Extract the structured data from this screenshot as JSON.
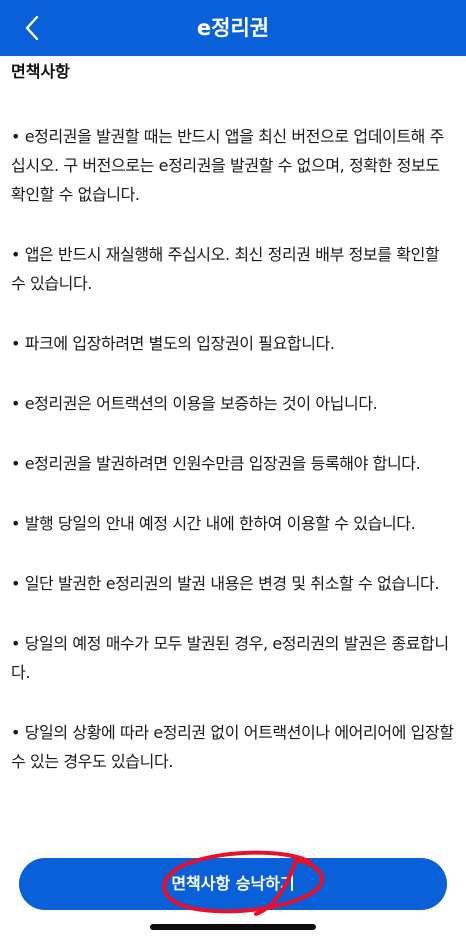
{
  "header": {
    "title": "e정리권",
    "back_icon": "chevron-left-icon"
  },
  "content": {
    "section_title": "면책사항",
    "items": [
      "• e정리권을 발권할 때는 반드시 앱을 최신 버전으로 업데이트해 주십시오. 구 버전으로는 e정리권을 발권할 수 없으며, 정확한 정보도 확인할 수 없습니다.",
      "• 앱은 반드시 재실행해 주십시오. 최신 정리권 배부 정보를 확인할 수 있습니다.",
      "• 파크에 입장하려면 별도의 입장권이 필요합니다.",
      "• e정리권은 어트랙션의 이용을 보증하는 것이 아닙니다.",
      "• e정리권을 발권하려면 인원수만큼 입장권을 등록해야 합니다.",
      "• 발행 당일의 안내 예정 시간 내에 한하여 이용할 수 있습니다.",
      "• 일단 발권한 e정리권의 발권 내용은 변경 및 취소할 수 없습니다.",
      "• 당일의 예정 매수가 모두 발권된 경우, e정리권의 발권은 종료합니다.",
      "• 당일의 상황에 따라 e정리권 없이 어트랙션이나 에어리어에 입장할 수 있는 경우도 있습니다."
    ]
  },
  "footer": {
    "agree_label": "면책사항 승낙하기"
  },
  "colors": {
    "brand": "#0a60d8",
    "annotation": "#e8102a"
  }
}
